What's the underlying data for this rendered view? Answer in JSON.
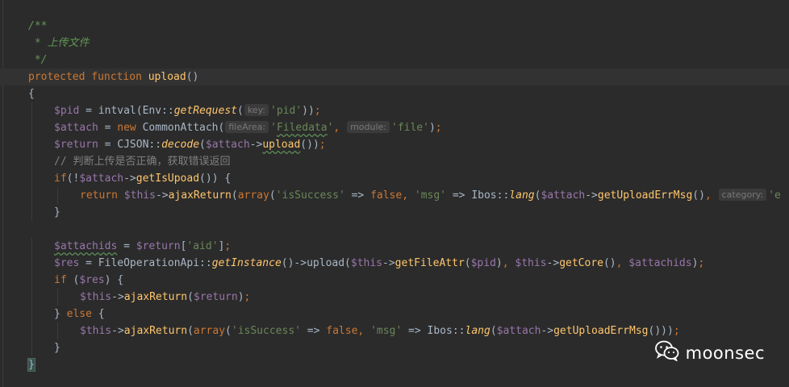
{
  "editor": {
    "lines": [
      {
        "tokens": [
          {
            "c": "cmt",
            "t": "/**"
          }
        ]
      },
      {
        "tokens": [
          {
            "c": "cmt",
            "t": " * 上传文件"
          }
        ]
      },
      {
        "tokens": [
          {
            "c": "cmt",
            "t": " */"
          }
        ]
      },
      {
        "current": true,
        "tokens": [
          {
            "c": "kw",
            "t": "protected "
          },
          {
            "c": "kw",
            "t": "function "
          },
          {
            "c": "fn",
            "t": "upload"
          },
          {
            "c": "cls",
            "t": "()"
          }
        ]
      },
      {
        "tokens": [
          {
            "c": "cls",
            "t": "{"
          }
        ]
      },
      {
        "indent": 1,
        "tokens": [
          {
            "c": "var",
            "t": "$pid"
          },
          {
            "c": "cls",
            "t": " = intval(Env::"
          },
          {
            "c": "st",
            "t": "getRequest"
          },
          {
            "c": "cls",
            "t": "("
          },
          {
            "hint": "key:"
          },
          {
            "c": "str",
            "t": "'pid'"
          },
          {
            "c": "cls",
            "t": "))"
          },
          {
            "c": "kw",
            "t": ";"
          }
        ]
      },
      {
        "indent": 1,
        "tokens": [
          {
            "c": "var",
            "t": "$attach"
          },
          {
            "c": "cls",
            "t": " = "
          },
          {
            "c": "kw",
            "t": "new "
          },
          {
            "c": "cls",
            "t": "CommonAttach("
          },
          {
            "hint": "fileArea:"
          },
          {
            "c": "str",
            "t": "'"
          },
          {
            "c": "str typo",
            "t": "Filedata"
          },
          {
            "c": "str",
            "t": "'"
          },
          {
            "c": "kw",
            "t": ", "
          },
          {
            "hint": "module:"
          },
          {
            "c": "str",
            "t": "'file'"
          },
          {
            "c": "cls",
            "t": ")"
          },
          {
            "c": "kw",
            "t": ";"
          }
        ]
      },
      {
        "indent": 1,
        "tokens": [
          {
            "c": "var",
            "t": "$return"
          },
          {
            "c": "cls",
            "t": " = CJSON::"
          },
          {
            "c": "st",
            "t": "decode"
          },
          {
            "c": "cls",
            "t": "("
          },
          {
            "c": "var",
            "t": "$attach"
          },
          {
            "c": "cls",
            "t": "->"
          },
          {
            "c": "fn typo",
            "t": "upload"
          },
          {
            "c": "cls",
            "t": "())"
          },
          {
            "c": "kw",
            "t": ";"
          }
        ]
      },
      {
        "indent": 1,
        "tokens": [
          {
            "c": "lcmt",
            "t": "// 判断上传是否正确，获取错误返回"
          }
        ]
      },
      {
        "indent": 1,
        "tokens": [
          {
            "c": "kw",
            "t": "if"
          },
          {
            "c": "cls",
            "t": "(!"
          },
          {
            "c": "var",
            "t": "$attach"
          },
          {
            "c": "cls",
            "t": "->"
          },
          {
            "c": "fn",
            "t": "getIsUpoad"
          },
          {
            "c": "cls",
            "t": "()) {"
          }
        ]
      },
      {
        "indent": 2,
        "tokens": [
          {
            "c": "kw",
            "t": "return "
          },
          {
            "c": "var",
            "t": "$this"
          },
          {
            "c": "cls",
            "t": "->"
          },
          {
            "c": "fn",
            "t": "ajaxReturn"
          },
          {
            "c": "cls",
            "t": "("
          },
          {
            "c": "kw",
            "t": "array"
          },
          {
            "c": "cls",
            "t": "("
          },
          {
            "c": "str",
            "t": "'isSuccess'"
          },
          {
            "c": "cls",
            "t": " => "
          },
          {
            "c": "kw",
            "t": "false"
          },
          {
            "c": "kw",
            "t": ", "
          },
          {
            "c": "str",
            "t": "'msg'"
          },
          {
            "c": "cls",
            "t": " => Ibos::"
          },
          {
            "c": "st",
            "t": "lang"
          },
          {
            "c": "cls",
            "t": "("
          },
          {
            "c": "var",
            "t": "$attach"
          },
          {
            "c": "cls",
            "t": "->"
          },
          {
            "c": "fn",
            "t": "getUploadErrMsg"
          },
          {
            "c": "cls",
            "t": "()"
          },
          {
            "c": "kw",
            "t": ", "
          },
          {
            "hint": "category:"
          },
          {
            "c": "str",
            "t": "'e"
          }
        ]
      },
      {
        "indent": 1,
        "tokens": [
          {
            "c": "cls",
            "t": "}"
          }
        ]
      },
      {
        "tokens": []
      },
      {
        "indent": 1,
        "tokens": [
          {
            "c": "var typo",
            "t": "$attachids"
          },
          {
            "c": "cls",
            "t": " = "
          },
          {
            "c": "var",
            "t": "$return"
          },
          {
            "c": "cls",
            "t": "["
          },
          {
            "c": "str",
            "t": "'aid'"
          },
          {
            "c": "cls",
            "t": "]"
          },
          {
            "c": "kw",
            "t": ";"
          }
        ]
      },
      {
        "indent": 1,
        "tokens": [
          {
            "c": "var",
            "t": "$res"
          },
          {
            "c": "cls",
            "t": " = FileOperationApi::"
          },
          {
            "c": "st",
            "t": "getInstance"
          },
          {
            "c": "cls",
            "t": "()->upload("
          },
          {
            "c": "var",
            "t": "$this"
          },
          {
            "c": "cls",
            "t": "->"
          },
          {
            "c": "fn",
            "t": "getFileAttr"
          },
          {
            "c": "cls",
            "t": "("
          },
          {
            "c": "var",
            "t": "$pid"
          },
          {
            "c": "cls",
            "t": ")"
          },
          {
            "c": "kw",
            "t": ", "
          },
          {
            "c": "var",
            "t": "$this"
          },
          {
            "c": "cls",
            "t": "->"
          },
          {
            "c": "fn",
            "t": "getCore"
          },
          {
            "c": "cls",
            "t": "()"
          },
          {
            "c": "kw",
            "t": ", "
          },
          {
            "c": "var",
            "t": "$attachids"
          },
          {
            "c": "cls",
            "t": ")"
          },
          {
            "c": "kw",
            "t": ";"
          }
        ]
      },
      {
        "indent": 1,
        "tokens": [
          {
            "c": "kw",
            "t": "if "
          },
          {
            "c": "cls",
            "t": "("
          },
          {
            "c": "var",
            "t": "$res"
          },
          {
            "c": "cls",
            "t": ") {"
          }
        ]
      },
      {
        "indent": 2,
        "tokens": [
          {
            "c": "var",
            "t": "$this"
          },
          {
            "c": "cls",
            "t": "->"
          },
          {
            "c": "fn",
            "t": "ajaxReturn"
          },
          {
            "c": "cls",
            "t": "("
          },
          {
            "c": "var",
            "t": "$return"
          },
          {
            "c": "cls",
            "t": ")"
          },
          {
            "c": "kw",
            "t": ";"
          }
        ]
      },
      {
        "indent": 1,
        "tokens": [
          {
            "c": "cls",
            "t": "} "
          },
          {
            "c": "kw",
            "t": "else "
          },
          {
            "c": "cls",
            "t": "{"
          }
        ]
      },
      {
        "indent": 2,
        "tokens": [
          {
            "c": "var",
            "t": "$this"
          },
          {
            "c": "cls",
            "t": "->"
          },
          {
            "c": "fn",
            "t": "ajaxReturn"
          },
          {
            "c": "cls",
            "t": "("
          },
          {
            "c": "kw",
            "t": "array"
          },
          {
            "c": "cls",
            "t": "("
          },
          {
            "c": "str",
            "t": "'isSuccess'"
          },
          {
            "c": "cls",
            "t": " => "
          },
          {
            "c": "kw",
            "t": "false"
          },
          {
            "c": "kw",
            "t": ", "
          },
          {
            "c": "str",
            "t": "'msg'"
          },
          {
            "c": "cls",
            "t": " => Ibos::"
          },
          {
            "c": "st",
            "t": "lang"
          },
          {
            "c": "cls",
            "t": "("
          },
          {
            "c": "var",
            "t": "$attach"
          },
          {
            "c": "cls",
            "t": "->"
          },
          {
            "c": "fn",
            "t": "getUploadErrMsg"
          },
          {
            "c": "cls",
            "t": "()))"
          },
          {
            "c": "kw",
            "t": ";"
          }
        ]
      },
      {
        "indent": 1,
        "tokens": [
          {
            "c": "cls",
            "t": "}"
          }
        ]
      },
      {
        "tokens": [
          {
            "c": "cls brace-match",
            "t": "}"
          }
        ]
      }
    ]
  },
  "watermark": {
    "text": "moonsec",
    "icon": "wechat-icon"
  },
  "colors": {
    "background": "#2b2b2b",
    "keyword": "#cc7832",
    "function": "#ffc66d",
    "variable": "#9876aa",
    "string": "#6a8759",
    "doc_comment": "#629755",
    "line_comment": "#808080",
    "default_text": "#a9b7c6"
  }
}
